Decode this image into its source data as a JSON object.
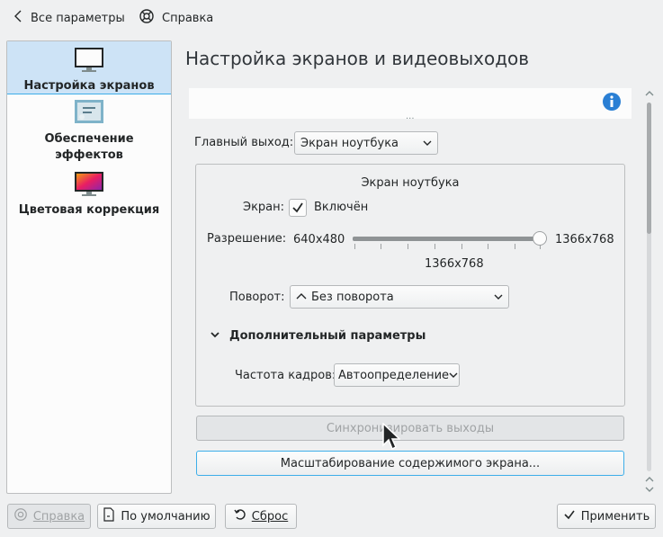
{
  "topbar": {
    "back_label": "Все параметры",
    "help_label": "Справка"
  },
  "sidebar": {
    "items": [
      {
        "label": "Настройка экранов"
      },
      {
        "label": "Обеспечение эффектов"
      },
      {
        "label": "Цветовая коррекция"
      }
    ]
  },
  "page": {
    "title": "Настройка экранов и видеовыходов",
    "primary_output_label": "Главный выход:",
    "primary_output_value": "Экран ноутбука",
    "group_title": "Экран ноутбука",
    "screen_label": "Экран:",
    "screen_enabled_label": "Включён",
    "screen_enabled": true,
    "resolution_label": "Разрешение:",
    "resolution_min": "640x480",
    "resolution_max": "1366x768",
    "resolution_current": "1366x768",
    "resolution_fraction": 1.0,
    "rotation_label": "Поворот:",
    "rotation_value": "Без поворота",
    "advanced_label": "Дополнительный параметры",
    "refresh_label": "Частота кадров:",
    "refresh_value": "Автоопределение",
    "sync_button": "Синхронизировать выходы",
    "scale_button": "Масштабирование содержимого экрана...",
    "preview_handle": "..."
  },
  "footer": {
    "help_label": "Справка",
    "defaults_label": "По умолчанию",
    "reset_label": "Сброс",
    "apply_label": "Применить"
  },
  "colors": {
    "accent": "#3daee9",
    "info": "#2a7fd4"
  }
}
